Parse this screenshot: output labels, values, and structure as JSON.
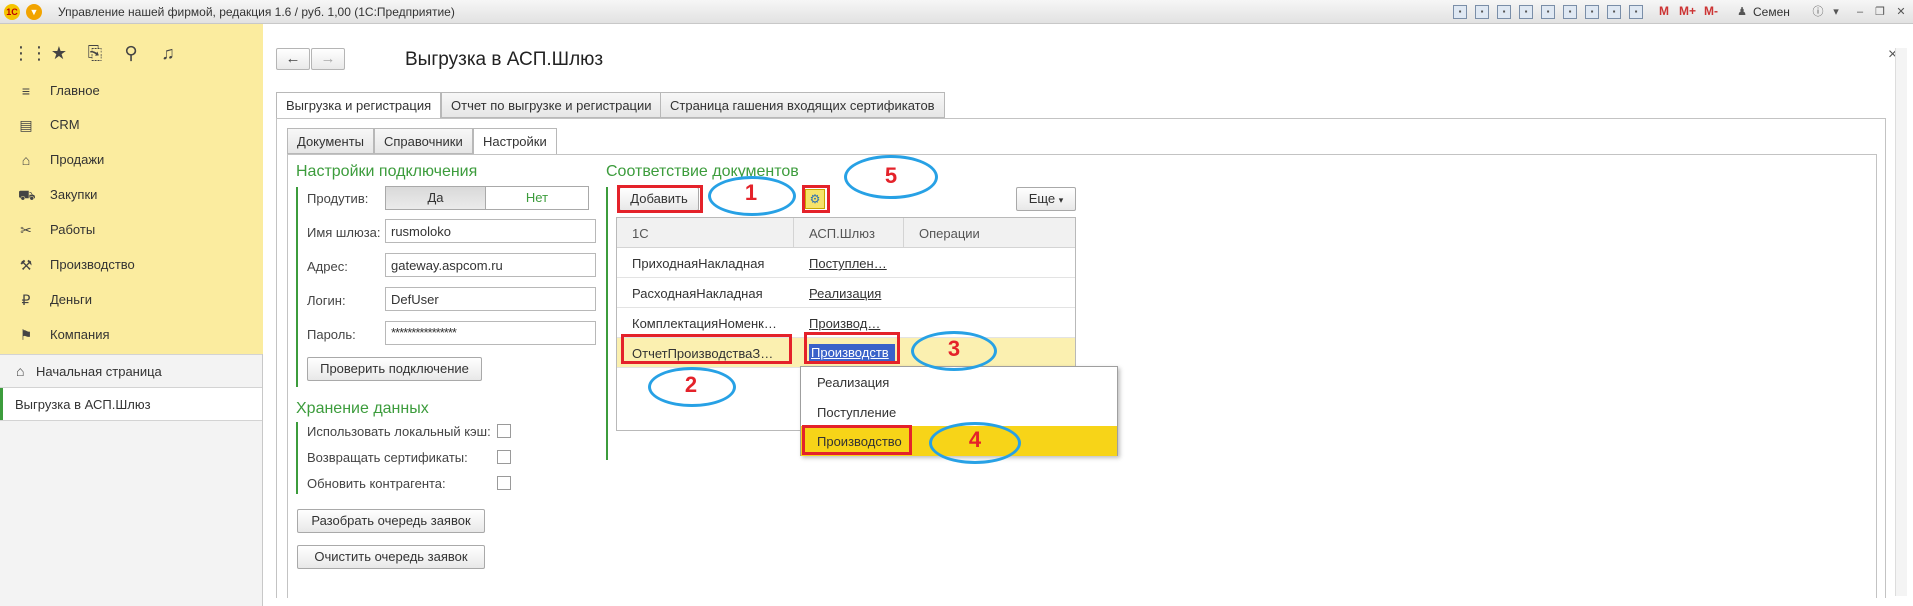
{
  "window": {
    "title": "Управление нашей фирмой, редакция 1.6 / руб. 1,00  (1С:Предприятие)",
    "logo_text": "1С",
    "user": "Семен",
    "toolbar_m": [
      "M",
      "M+",
      "M-"
    ]
  },
  "sidebar": {
    "sections": [
      {
        "icon": "≡",
        "label": "Главное"
      },
      {
        "icon": "▤",
        "label": "CRM"
      },
      {
        "icon": "⌂",
        "label": "Продажи"
      },
      {
        "icon": "⛟",
        "label": "Закупки"
      },
      {
        "icon": "✂",
        "label": "Работы"
      },
      {
        "icon": "⚒",
        "label": "Производство"
      },
      {
        "icon": "₽",
        "label": "Деньги"
      },
      {
        "icon": "⚑",
        "label": "Компания"
      }
    ],
    "open_windows": [
      {
        "icon": "⌂",
        "label": "Начальная страница"
      },
      {
        "label": "Выгрузка в АСП.Шлюз"
      }
    ]
  },
  "form": {
    "title": "Выгрузка в АСП.Шлюз",
    "main_tabs": [
      "Выгрузка и регистрация",
      "Отчет по выгрузке и регистрации",
      "Страница гашения входящих сертификатов"
    ],
    "sub_tabs": [
      "Документы",
      "Справочники",
      "Настройки"
    ],
    "connection": {
      "title": "Настройки подключения",
      "productive_label": "Продутив:",
      "yes": "Да",
      "no": "Нет",
      "gateway_label": "Имя шлюза:",
      "gateway_value": "rusmoloko",
      "address_label": "Адрес:",
      "address_value": "gateway.aspcom.ru",
      "login_label": "Логин:",
      "login_value": "DefUser",
      "password_label": "Пароль:",
      "password_value": "****************",
      "check_button": "Проверить подключение"
    },
    "storage": {
      "title": "Хранение данных",
      "use_cache": "Использовать локальный кэш:",
      "return_certs": "Возвращать сертификаты:",
      "update_contractor": "Обновить контрагента:"
    },
    "parse_queue_button": "Разобрать очередь заявок",
    "clear_queue_button": "Очистить очередь заявок",
    "mapping": {
      "title": "Соответствие документов",
      "add_button": "Добавить",
      "more_button": "Еще",
      "columns": [
        "1С",
        "АСП.Шлюз",
        "Операции"
      ],
      "rows": [
        {
          "c1": "ПриходнаяНакладная",
          "c2": "Поступлен…"
        },
        {
          "c1": "РасходнаяНакладная",
          "c2": "Реализация"
        },
        {
          "c1": "КомплектацияНоменк…",
          "c2": "Производ…"
        },
        {
          "c1": "ОтчетПроизводстваЗ…",
          "c2": "Производств"
        }
      ],
      "dropdown": [
        "Реализация",
        "Поступление",
        "Производство"
      ]
    }
  },
  "annotations": [
    "1",
    "2",
    "3",
    "4",
    "5"
  ]
}
